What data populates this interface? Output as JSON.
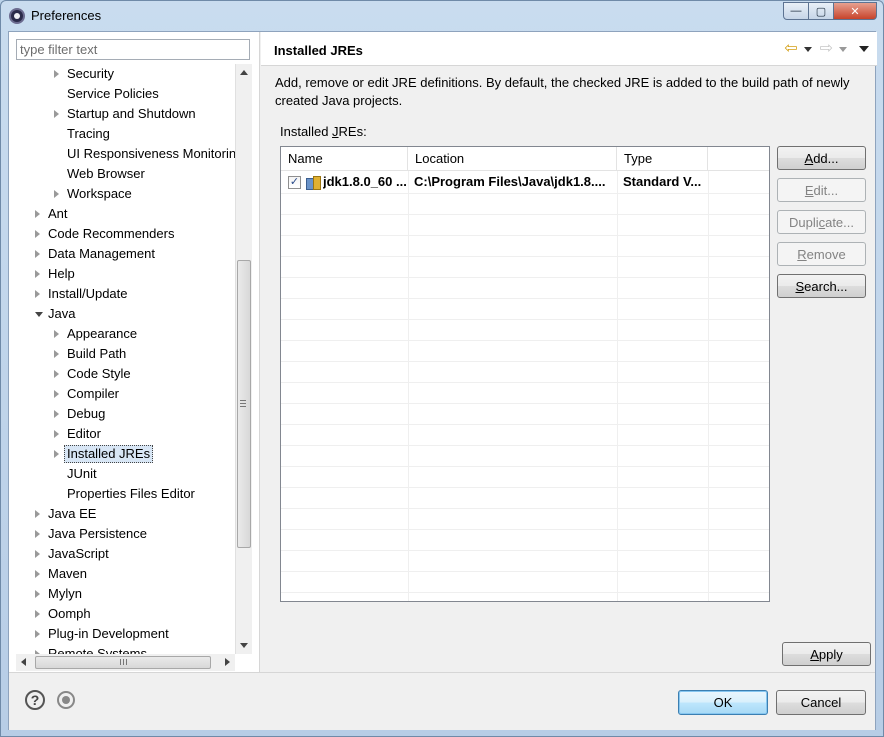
{
  "window": {
    "title": "Preferences",
    "controls": {
      "minimize": "—",
      "maximize": "▢",
      "close": "✕"
    }
  },
  "filter": {
    "placeholder": "type filter text"
  },
  "tree": {
    "items": [
      {
        "label": "Security",
        "expander": "collapsed"
      },
      {
        "label": "Service Policies",
        "expander": "none"
      },
      {
        "label": "Startup and Shutdown",
        "expander": "collapsed"
      },
      {
        "label": "Tracing",
        "expander": "none"
      },
      {
        "label": "UI Responsiveness Monitoring",
        "expander": "none"
      },
      {
        "label": "Web Browser",
        "expander": "none"
      },
      {
        "label": "Workspace",
        "expander": "collapsed"
      },
      {
        "label": "Ant",
        "expander": "collapsed"
      },
      {
        "label": "Code Recommenders",
        "expander": "collapsed"
      },
      {
        "label": "Data Management",
        "expander": "collapsed"
      },
      {
        "label": "Help",
        "expander": "collapsed"
      },
      {
        "label": "Install/Update",
        "expander": "collapsed"
      },
      {
        "label": "Java",
        "expander": "expanded"
      },
      {
        "label": "Appearance",
        "expander": "collapsed"
      },
      {
        "label": "Build Path",
        "expander": "collapsed"
      },
      {
        "label": "Code Style",
        "expander": "collapsed"
      },
      {
        "label": "Compiler",
        "expander": "collapsed"
      },
      {
        "label": "Debug",
        "expander": "collapsed"
      },
      {
        "label": "Editor",
        "expander": "collapsed"
      },
      {
        "label": "Installed JREs",
        "expander": "collapsed",
        "selected": true
      },
      {
        "label": "JUnit",
        "expander": "none"
      },
      {
        "label": "Properties Files Editor",
        "expander": "none"
      },
      {
        "label": "Java EE",
        "expander": "collapsed"
      },
      {
        "label": "Java Persistence",
        "expander": "collapsed"
      },
      {
        "label": "JavaScript",
        "expander": "collapsed"
      },
      {
        "label": "Maven",
        "expander": "collapsed"
      },
      {
        "label": "Mylyn",
        "expander": "collapsed"
      },
      {
        "label": "Oomph",
        "expander": "collapsed"
      },
      {
        "label": "Plug-in Development",
        "expander": "collapsed"
      },
      {
        "label": "Remote Systems",
        "expander": "collapsed"
      }
    ]
  },
  "page": {
    "title": "Installed JREs",
    "description": "Add, remove or edit JRE definitions. By default, the checked JRE is added to the build path of newly created Java projects.",
    "installed_label": "Installed JREs:",
    "installed_label_mnemonic": "J",
    "table": {
      "columns": [
        "Name",
        "Location",
        "Type"
      ],
      "rows": [
        {
          "checked": true,
          "check_glyph": "✓",
          "name": "jdk1.8.0_60 ...",
          "location": "C:\\Program Files\\Java\\jdk1.8....",
          "type": "Standard V..."
        }
      ]
    },
    "buttons": {
      "add": "Add...",
      "edit": "Edit...",
      "duplicate": "Duplicate...",
      "remove": "Remove",
      "search": "Search...",
      "apply": "Apply"
    }
  },
  "nav": {
    "back": "⇦",
    "forward": "⇨"
  },
  "footer": {
    "help_glyph": "?",
    "ok": "OK",
    "cancel": "Cancel"
  },
  "colors": {
    "selection": "#d8e6f5",
    "default_button_border": "#3c7fb1",
    "back_arrow": "#d4a017"
  }
}
